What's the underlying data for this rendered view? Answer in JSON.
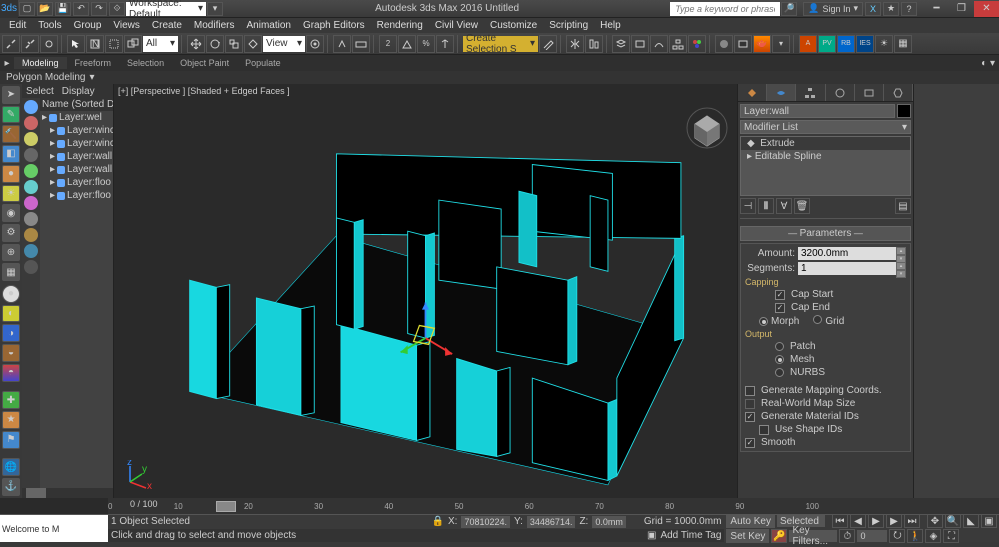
{
  "titlebar": {
    "workspace": "Workspace: Default",
    "title": "Autodesk 3ds Max 2016   Untitled",
    "search_placeholder": "Type a keyword or phrase",
    "signin": "Sign In"
  },
  "menu": [
    "Edit",
    "Tools",
    "Group",
    "Views",
    "Create",
    "Modifiers",
    "Animation",
    "Graph Editors",
    "Rendering",
    "Civil View",
    "Customize",
    "Scripting",
    "Help"
  ],
  "toolbar": {
    "all_label": "All",
    "view_label": "View",
    "selset": "Create Selection S"
  },
  "ribbon": {
    "tabs": [
      "Modeling",
      "Freeform",
      "Selection",
      "Object Paint",
      "Populate"
    ],
    "band": "Polygon Modeling"
  },
  "scene": {
    "hdr_select": "Select",
    "hdr_display": "Display",
    "col": "Name (Sorted Descen",
    "items": [
      "Layer:wel",
      "Layer:winc",
      "Layer:winc",
      "Layer:wall",
      "Layer:wall",
      "Layer:floo",
      "Layer:floo"
    ]
  },
  "viewport": {
    "label": "[+] [Perspective ] [Shaded + Edged Faces ]"
  },
  "cmd": {
    "objname": "Layer:wall",
    "modlist": "Modifier List",
    "stack": [
      "Extrude",
      "Editable Spline"
    ],
    "rollout1": "Parameters",
    "amount_lbl": "Amount:",
    "amount_val": "3200.0mm",
    "segments_lbl": "Segments:",
    "segments_val": "1",
    "capping": "Capping",
    "cap_start": "Cap Start",
    "cap_end": "Cap End",
    "morph": "Morph",
    "grid": "Grid",
    "output": "Output",
    "patch": "Patch",
    "mesh": "Mesh",
    "nurbs": "NURBS",
    "gen_map": "Generate Mapping Coords.",
    "rw_map": "Real-World Map Size",
    "gen_mat": "Generate Material IDs",
    "use_shape": "Use Shape IDs",
    "smooth": "Smooth"
  },
  "timeline": {
    "frame": "0 / 100",
    "ticks": [
      "0",
      "10",
      "20",
      "30",
      "40",
      "50",
      "60",
      "70",
      "80",
      "90",
      "100"
    ]
  },
  "status": {
    "welcome": "Welcome to M",
    "selcount": "1 Object Selected",
    "prompt": "Click and drag to select and move objects",
    "x": "70810224.",
    "y": "34486714.",
    "z": "0.0mm",
    "grid": "Grid = 1000.0mm",
    "addtag": "Add Time Tag",
    "autokey": "Auto Key",
    "setkey": "Set Key",
    "selected": "Selected",
    "keyfilt": "Key Filters..."
  }
}
